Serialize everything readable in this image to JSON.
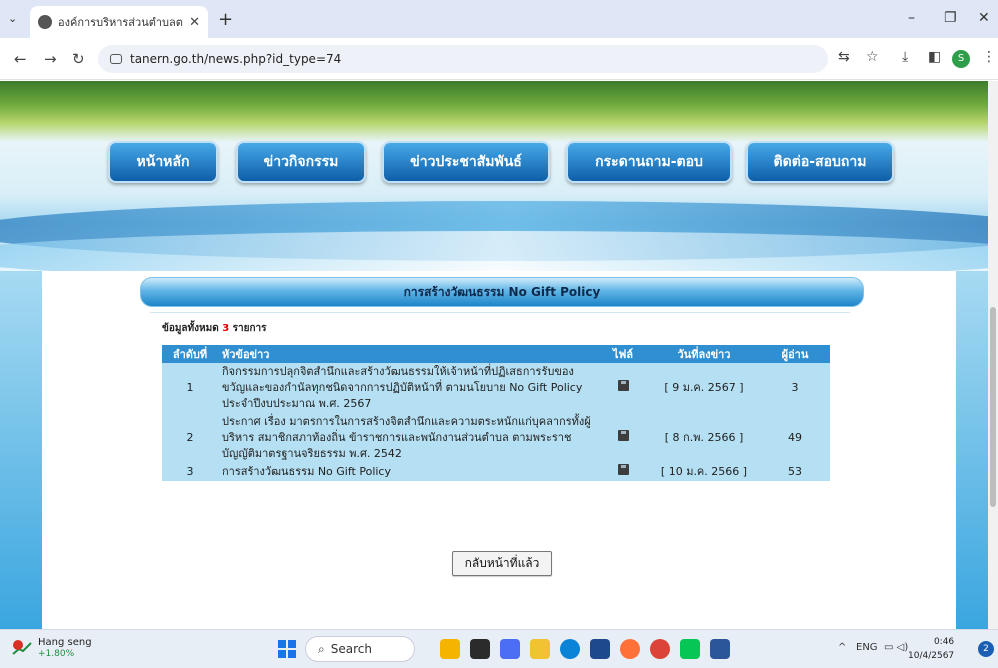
{
  "browser": {
    "tab_title": "องค์การบริหารส่วนตำบลตาเณิน อำเภ",
    "tab_close": "✕",
    "new_tab": "+",
    "url": "tanern.go.th/news.php?id_type=74",
    "profile_initial": "S"
  },
  "site": {
    "menu": [
      {
        "label": "หน้าหลัก"
      },
      {
        "label": "ข่าวกิจกรรม"
      },
      {
        "label": "ข่าวประชาสัมพันธ์"
      },
      {
        "label": "กระดานถาม-ตอบ"
      },
      {
        "label": "ติดต่อ-สอบถาม"
      }
    ],
    "section_title": "การสร้างวัฒนธรรม No Gift Policy",
    "count_prefix": "ข้อมูลทั้งหมด",
    "count_value": "3",
    "count_suffix": "รายการ",
    "table": {
      "headers": {
        "no": "ลำดับที่",
        "title": "หัวข้อข่าว",
        "file": "ไฟล์",
        "date": "วันที่ลงข่าว",
        "readers": "ผู้อ่าน"
      },
      "rows": [
        {
          "no": "1",
          "title": "กิจกรรมการปลุกจิตสำนึกและสร้างวัฒนธรรมให้เจ้าหน้าที่ปฏิเสธการรับของขวัญและของกำนัลทุกชนิดจากการปฏิบัติหน้าที่ ตามนโยบาย No Gift Policy ประจำปีงบประมาณ พ.ศ. 2567",
          "date": "[ 9 ม.ค. 2567 ]",
          "readers": "3"
        },
        {
          "no": "2",
          "title": "ประกาศ เรื่อง มาตรการในการสร้างจิตสำนึกและความตระหนักแก่บุคลากรทั้งผู้บริหาร สมาชิกสภาท้องถิ่น ข้าราชการและพนักงานส่วนตำบล ตามพระราชบัญญัติมาตรฐานจริยธรรม พ.ศ. 2542",
          "date": "[ 8 ก.พ. 2566 ]",
          "readers": "49"
        },
        {
          "no": "3",
          "title": "การสร้างวัฒนธรรม No Gift Policy",
          "date": "[ 10 ม.ค. 2566 ]",
          "readers": "53"
        }
      ]
    },
    "back_button": "กลับหน้าที่แล้ว"
  },
  "taskbar": {
    "stock_name": "Hang seng",
    "stock_change": "+1.80%",
    "search_label": "Search",
    "lang": "ENG",
    "time": "0:46",
    "date": "10/4/2567",
    "notifications": "2"
  },
  "icons": [
    "chevron-down-icon",
    "globe-icon",
    "close-icon",
    "back-arrow-icon",
    "forward-arrow-icon",
    "reload-icon",
    "site-settings-icon",
    "translate-icon",
    "star-icon",
    "download-icon",
    "sidepanel-icon",
    "more-icon",
    "disk-icon",
    "windows-start-icon",
    "search-icon"
  ]
}
